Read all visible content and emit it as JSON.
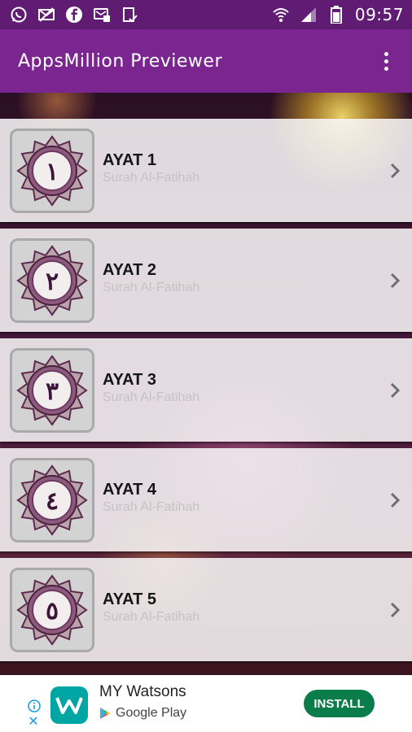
{
  "status_bar": {
    "time": "09:57",
    "left_icons": [
      "whatsapp-icon",
      "mail-off-icon",
      "facebook-icon",
      "sms-icon",
      "clipboard-check-icon"
    ],
    "right_icons": [
      "wifi-icon",
      "signal-icon",
      "battery-icon"
    ]
  },
  "app_bar": {
    "title": "AppsMillion Previewer",
    "overflow_icon": "more-vert-icon"
  },
  "list": {
    "items": [
      {
        "title": "AYAT 1",
        "subtitle": "Surah Al-Fatihah",
        "numeral": "١"
      },
      {
        "title": "AYAT 2",
        "subtitle": "Surah Al-Fatihah",
        "numeral": "٢"
      },
      {
        "title": "AYAT 3",
        "subtitle": "Surah Al-Fatihah",
        "numeral": "٣"
      },
      {
        "title": "AYAT 4",
        "subtitle": "Surah Al-Fatihah",
        "numeral": "٤"
      },
      {
        "title": "AYAT 5",
        "subtitle": "Surah Al-Fatihah",
        "numeral": "٥"
      }
    ],
    "chevron_icon": "chevron-right-icon"
  },
  "ad": {
    "title": "MY Watsons",
    "store": "Google Play",
    "button": "INSTALL",
    "logo_letter": "W",
    "colors": {
      "install": "#0b7d4a",
      "logo": "#00a6a3",
      "info": "#1c9be6"
    }
  },
  "colors": {
    "status_bar": "#5f1c72",
    "app_bar": "#7a2590"
  }
}
